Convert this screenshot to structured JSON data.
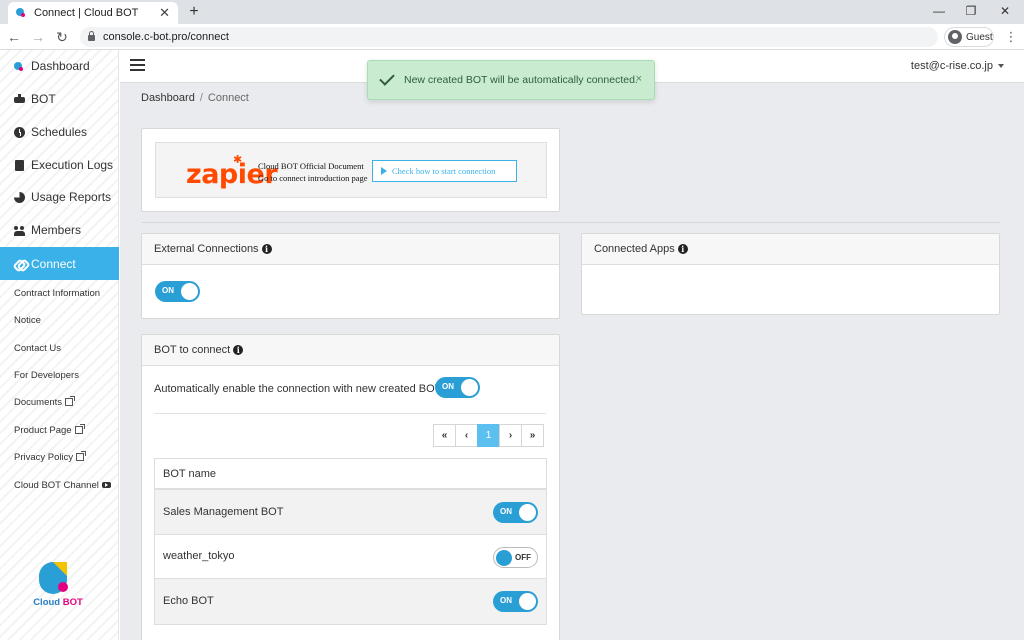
{
  "browser": {
    "tab_title": "Connect | Cloud BOT",
    "tab_close": "✕",
    "new_tab": "+",
    "url": "console.c-bot.pro/connect",
    "profile": "Guest",
    "menu": "⋮",
    "controls": {
      "minimize": "—",
      "restore": "❐",
      "close": "✕"
    },
    "nav": {
      "back": "←",
      "forward": "→",
      "reload": "↻"
    }
  },
  "sidebar": {
    "items": [
      {
        "label": "Dashboard",
        "icon": "dashboard-icon"
      },
      {
        "label": "BOT",
        "icon": "bot-icon"
      },
      {
        "label": "Schedules",
        "icon": "clock-icon"
      },
      {
        "label": "Execution Logs",
        "icon": "file-icon"
      },
      {
        "label": "Usage Reports",
        "icon": "pie-chart-icon"
      },
      {
        "label": "Members",
        "icon": "users-icon"
      },
      {
        "label": "Connect",
        "icon": "link-icon",
        "active": true
      }
    ],
    "links": [
      {
        "label": "Contract Information"
      },
      {
        "label": "Notice"
      },
      {
        "label": "Contact Us"
      },
      {
        "label": "For Developers"
      },
      {
        "label": "Documents",
        "external": true
      },
      {
        "label": "Product Page",
        "external": true
      },
      {
        "label": "Privacy Policy",
        "external": true
      },
      {
        "label": "Cloud BOT Channel",
        "youtube": true
      }
    ],
    "logo": {
      "text_a": "Cloud ",
      "text_b": "BOT"
    }
  },
  "header": {
    "user_email": "test@c-rise.co.jp"
  },
  "toast": {
    "message": "New created BOT will be automatically connected.",
    "close": "×"
  },
  "breadcrumb": {
    "home": "Dashboard",
    "separator": "/",
    "current": "Connect"
  },
  "zapier": {
    "logo": "zapier",
    "star": "✱",
    "doc_line1": "Cloud BOT Official Document",
    "doc_line2": "Go to connect introduction page",
    "button": "Check how to start connection"
  },
  "external_connections": {
    "title": "External Connections",
    "toggle": "ON"
  },
  "connected_apps": {
    "title": "Connected Apps"
  },
  "bot_to_connect": {
    "title": "BOT to connect",
    "auto_label": "Automatically enable the connection with new created BOT.",
    "auto_toggle": "ON",
    "pagination": {
      "first": "«",
      "prev": "‹",
      "page": "1",
      "next": "›",
      "last": "»"
    },
    "column_header": "BOT name",
    "rows": [
      {
        "name": "Sales Management BOT",
        "state": "ON"
      },
      {
        "name": "weather_tokyo",
        "state": "OFF"
      },
      {
        "name": "Echo BOT",
        "state": "ON"
      }
    ]
  },
  "colors": {
    "accent": "#3ab1e8",
    "toggle": "#2a9fd6",
    "toast_bg": "#c9ecd1",
    "zapier": "#ff4a00"
  }
}
